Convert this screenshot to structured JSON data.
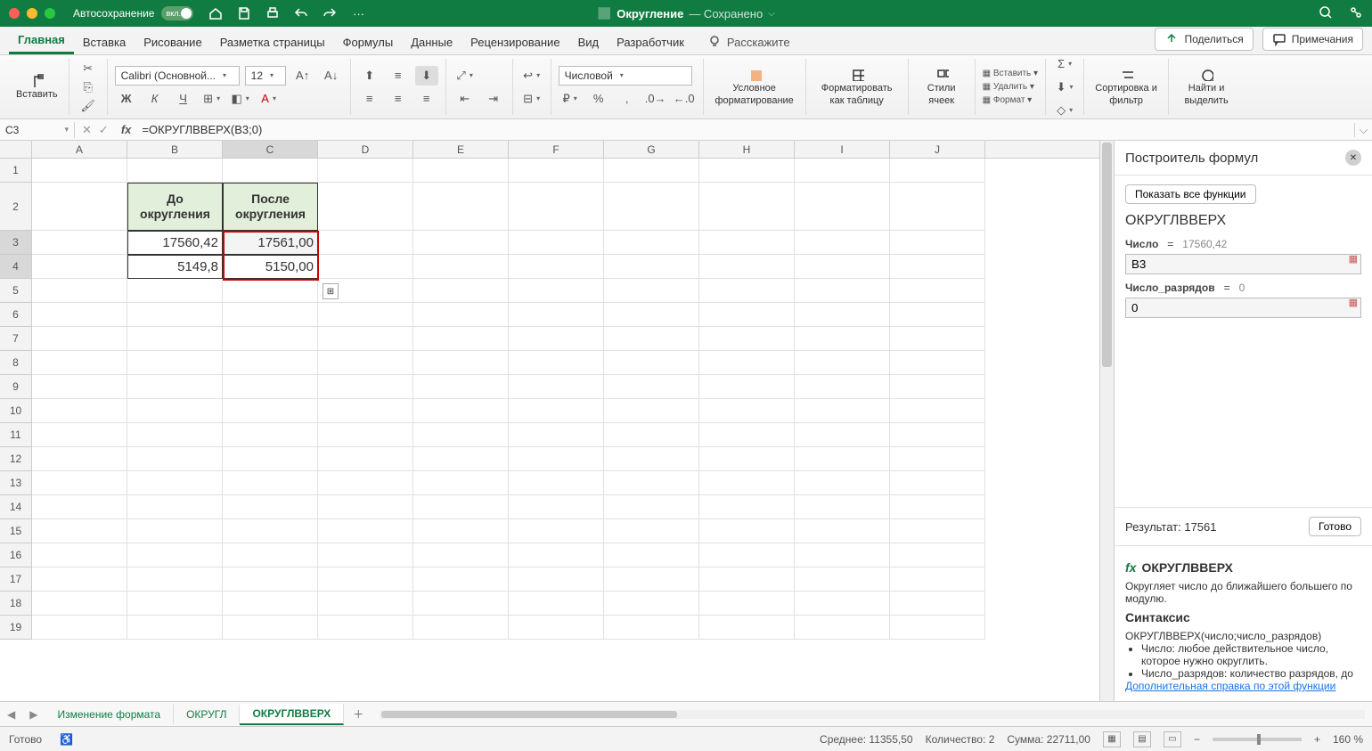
{
  "titlebar": {
    "autosave_label": "Автосохранение",
    "toggle_text": "вкл.",
    "doc_name": "Округление",
    "saved_label": "— Сохранено"
  },
  "tabs": [
    "Главная",
    "Вставка",
    "Рисование",
    "Разметка страницы",
    "Формулы",
    "Данные",
    "Рецензирование",
    "Вид",
    "Разработчик"
  ],
  "tell_me": "Расскажите",
  "share": "Поделиться",
  "comments": "Примечания",
  "ribbon": {
    "paste": "Вставить",
    "font_name": "Calibri (Основной...",
    "font_size": "12",
    "num_format": "Числовой",
    "cond_fmt": "Условное форматирование",
    "fmt_table": "Форматировать как таблицу",
    "cell_styles": "Стили ячеек",
    "insert": "Вставить",
    "delete": "Удалить",
    "format": "Формат",
    "sort": "Сортировка и фильтр",
    "find": "Найти и выделить"
  },
  "namebox": "C3",
  "formula": "=ОКРУГЛВВЕРХ(B3;0)",
  "columns": [
    "A",
    "B",
    "C",
    "D",
    "E",
    "F",
    "G",
    "H",
    "I",
    "J"
  ],
  "headers": {
    "b": "До округления",
    "c": "После округления"
  },
  "data": {
    "b3": "17560,42",
    "c3": "17561,00",
    "b4": "5149,8",
    "c4": "5150,00"
  },
  "sidepanel": {
    "title": "Построитель формул",
    "show_all": "Показать все функции",
    "fn_name": "ОКРУГЛВВЕРХ",
    "arg1_label": "Число",
    "arg1_eq": "=",
    "arg1_preview": "17560,42",
    "arg1_value": "B3",
    "arg2_label": "Число_разрядов",
    "arg2_eq": "=",
    "arg2_preview": "0",
    "arg2_value": "0",
    "result_label": "Результат: 17561",
    "done": "Готово",
    "help_title": "ОКРУГЛВВЕРХ",
    "help_desc": "Округляет число до ближайшего большего по модулю.",
    "syntax_label": "Синтаксис",
    "syntax_text": "ОКРУГЛВВЕРХ(число;число_разрядов)",
    "bullet1": "Число: любое действительное число, которое нужно округлить.",
    "bullet2": "Число_разрядов: количество разрядов, до",
    "more_help": "Дополнительная справка по этой функции"
  },
  "sheets": [
    "Изменение формата",
    "ОКРУГЛ",
    "ОКРУГЛВВЕРХ"
  ],
  "status": {
    "ready": "Готово",
    "avg": "Среднее: 11355,50",
    "count": "Количество: 2",
    "sum": "Сумма: 22711,00",
    "zoom": "160 %"
  }
}
